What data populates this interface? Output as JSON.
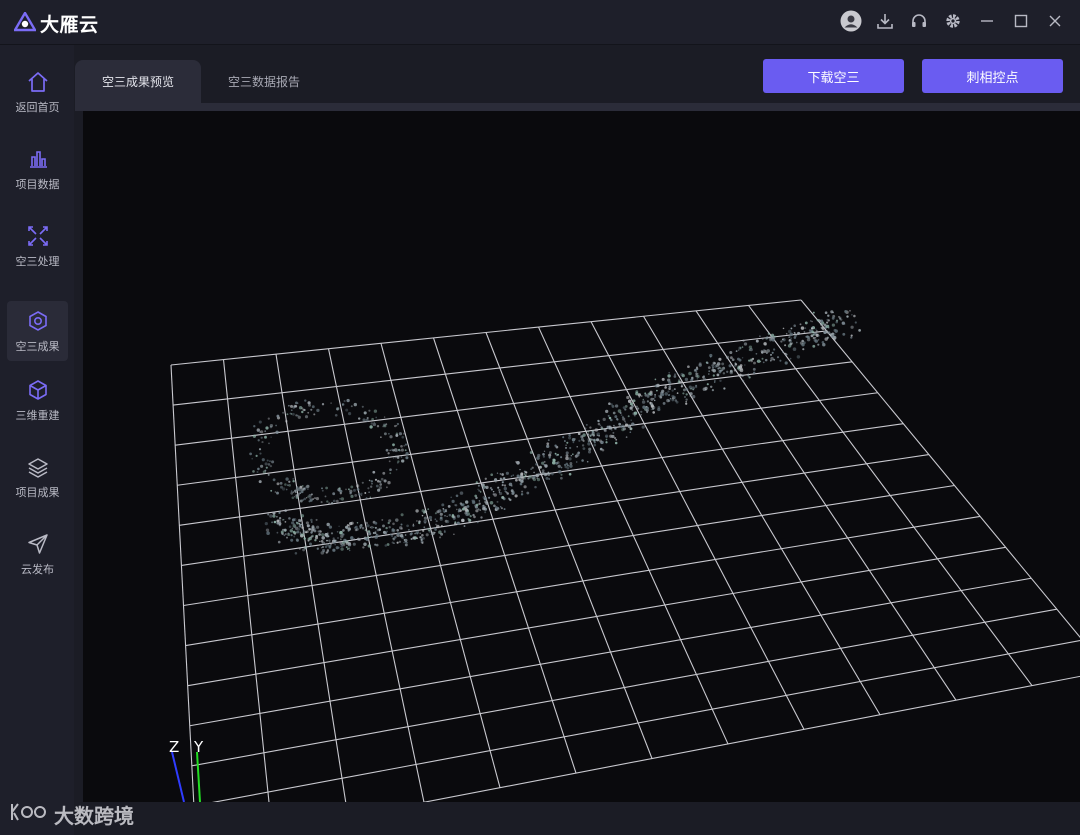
{
  "app": {
    "title": "大雁云"
  },
  "window_controls": [
    "user-icon",
    "download-icon",
    "headset-icon",
    "gear-icon",
    "minimize-icon",
    "maximize-icon",
    "close-icon"
  ],
  "sidebar": {
    "items": [
      {
        "label": "返回首页",
        "icon": "home-icon",
        "active": false
      },
      {
        "label": "项目数据",
        "icon": "bar-chart-icon",
        "active": false
      },
      {
        "label": "空三处理",
        "icon": "process-icon",
        "active": false
      },
      {
        "label": "空三成果",
        "icon": "aerial-result-icon",
        "active": true
      },
      {
        "label": "三维重建",
        "icon": "cube-icon",
        "active": false
      },
      {
        "label": "项目成果",
        "icon": "layers-icon",
        "active": false
      },
      {
        "label": "云发布",
        "icon": "send-icon",
        "active": false
      }
    ]
  },
  "main": {
    "tabs": [
      {
        "label": "空三成果预览",
        "active": true
      },
      {
        "label": "空三数据报告",
        "active": false
      }
    ],
    "actions": {
      "download": "下载空三",
      "tie_points": "刺相控点"
    }
  },
  "viewer": {
    "axes": {
      "z": "Z",
      "y": "Y"
    }
  },
  "watermark": {
    "text": "大数跨境"
  },
  "colors": {
    "accent": "#6a5cf1",
    "background": "#1b1c25",
    "viewer_bg": "#0a0a0d"
  }
}
